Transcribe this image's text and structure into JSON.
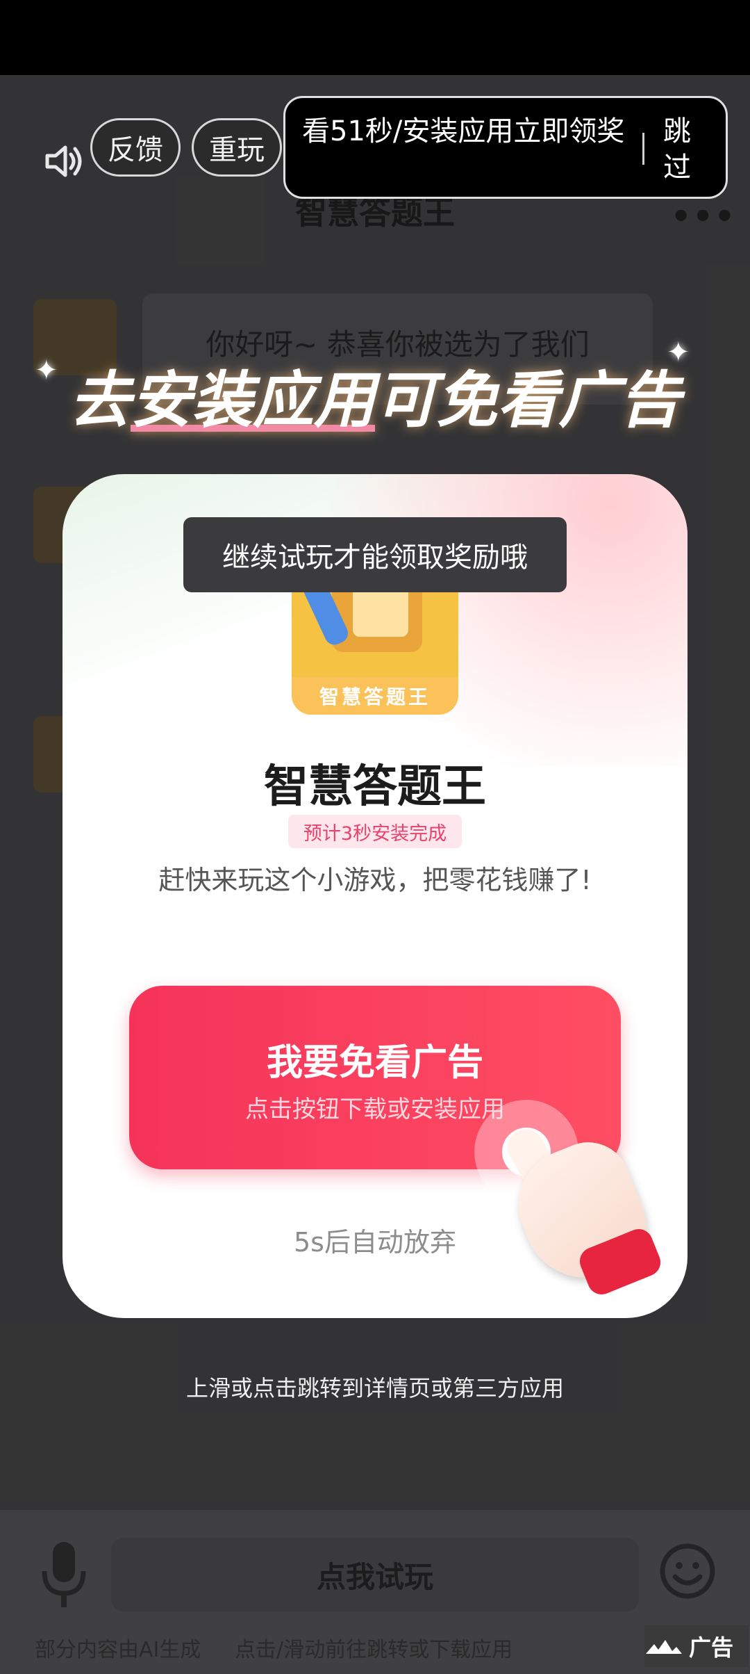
{
  "page": {
    "header_title": "智慧答题王",
    "more_label": "•••",
    "chat_text": "你好呀~ 恭喜你被选为了我们"
  },
  "ad_controls": {
    "feedback_label": "反馈",
    "replay_label": "重玩",
    "reward_text": "看51秒/安装应用立即领奖",
    "skip_label": "跳过"
  },
  "promo": {
    "headline_part1": "去",
    "headline_highlight": "安装应用",
    "headline_part2": "可免看广告"
  },
  "toast": "继续试玩才能领取奖励哦",
  "app": {
    "icon_label": "智慧答题王",
    "name": "智慧答题王",
    "badge": "预计3秒安装完成",
    "description": "赶快来玩这个小游戏，把零花钱赚了!"
  },
  "cta": {
    "title": "我要免看广告",
    "subtitle": "点击按钮下载或安装应用"
  },
  "countdown": "5s后自动放弃",
  "swipe_hint": "上滑或点击跳转到详情页或第三方应用",
  "bottom": {
    "try_label": "点我试玩",
    "ai_note": "部分内容由AI生成",
    "jump_note": "点击/滑动前往跳转或下载应用",
    "ad_tag": "广告"
  },
  "colors": {
    "cta_start": "#f5335a",
    "cta_end": "#ff4e63",
    "badge_text": "#e8436a"
  }
}
